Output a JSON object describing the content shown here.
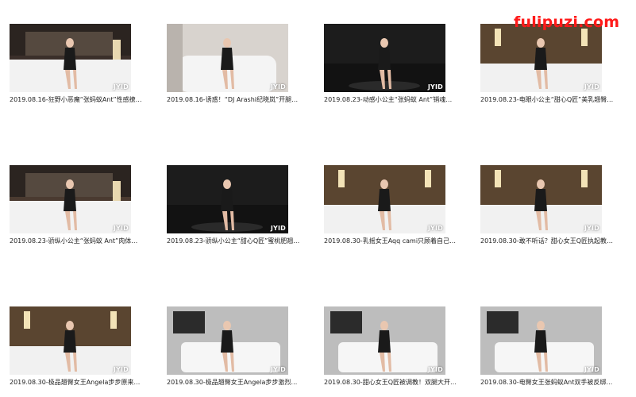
{
  "watermark": "fulipuzi.com",
  "badge_text": "JYID",
  "items": [
    {
      "caption": "2019.08.16-狂野小恶魔“张蚂蚁Ant”性感撩人...",
      "scene": "bedroom",
      "bg": "#3a2f2a"
    },
    {
      "caption": "2019.08.16-诱惑！“DJ Arashi纪晓岚”开腿狂...",
      "scene": "sofa",
      "bg": "#c9c4bf"
    },
    {
      "caption": "2019.08.23-动感小公主“张蚂蚁 Ant”销魂小狗...",
      "scene": "stage",
      "bg": "#111111"
    },
    {
      "caption": "2019.08.23-电眼小公主“甜心Q匠”美乳翘臀狂...",
      "scene": "hotel",
      "bg": "#8a6a4a"
    },
    {
      "caption": "2019.08.23-骄纵小公主“张蚂蚁 Ant”肉体开撩...",
      "scene": "bedroom",
      "bg": "#4a3a30"
    },
    {
      "caption": "2019.08.23-骄纵小公主“甜心Q匠”蜜桃肥翘极...",
      "scene": "stage",
      "bg": "#151515"
    },
    {
      "caption": "2019.08.30-乳摇女王Aqq cami只顾着自己揉...",
      "scene": "hotel",
      "bg": "#6b5138"
    },
    {
      "caption": "2019.08.30-敢不听话？甜心女王Q匠执起教鞭...",
      "scene": "hotel",
      "bg": "#7a5a3e"
    },
    {
      "caption": "2019.08.30-极品翘臀女王Angela步步原来是...",
      "scene": "hotel",
      "bg": "#6a4a30"
    },
    {
      "caption": "2019.08.30-极品翘臀女王Angela步步激烈自...",
      "scene": "bath",
      "bg": "#8f8f8f"
    },
    {
      "caption": "2019.08.30-甜心女王Q匠被调教！双腿大开翘...",
      "scene": "bath",
      "bg": "#9a9a9a"
    },
    {
      "caption": "2019.08.30-电臀女王张蚂蚁Ant双手被反绑只...",
      "scene": "bath",
      "bg": "#a0a0a0"
    }
  ]
}
